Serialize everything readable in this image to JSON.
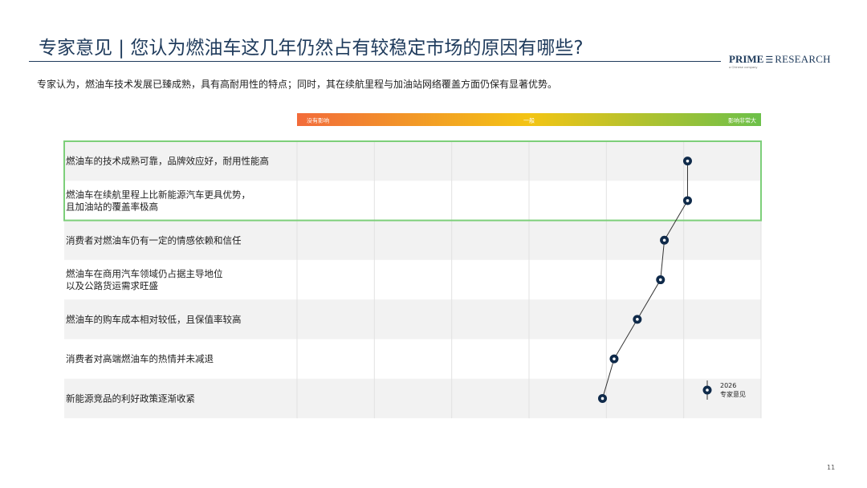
{
  "header": {
    "title": "专家意见 | 您认为燃油车这几年仍然占有较稳定市场的原因有哪些?",
    "subtitle": "专家认为，燃油车技术发展已臻成熟，具有高耐用性的特点；同时，其在续航里程与加油站网络覆盖方面仍保有显著优势。"
  },
  "logo": {
    "brand_bold": "PRIME",
    "brand_mark": "☰",
    "brand_light": "RESEARCH",
    "tagline": "a Chinese company"
  },
  "page_number": "11",
  "colors": {
    "title": "#1f3b5c",
    "gradient_left": "#f26b3a",
    "gradient_mid": "#f3c414",
    "gradient_right": "#6cc04a",
    "highlight_border": "#7dcf7a",
    "marker": "#0f2a4a",
    "row_shade": "#f2f2f2"
  },
  "chart_data": {
    "type": "line",
    "orientation": "horizontal-rows",
    "scale_labels": [
      "没有影响",
      "一般",
      "影响非常大"
    ],
    "x_range": [
      0,
      6
    ],
    "categories": [
      [
        "燃油车的技术成熟可靠，品牌效应好，耐用性能高"
      ],
      [
        "燃油车在续航里程上比新能源汽车更具优势，",
        "且加油站的覆盖率极高"
      ],
      [
        "消费者对燃油车仍有一定的情感依赖和信任"
      ],
      [
        "燃油车在商用汽车领域仍占据主导地位",
        "以及公路货运需求旺盛"
      ],
      [
        "燃油车的购车成本相对较低，且保值率较高"
      ],
      [
        "消费者对高端燃油车的热情并未减退"
      ],
      [
        "新能源竞品的利好政策逐渐收紧"
      ]
    ],
    "series": [
      {
        "name": "2026 专家意见",
        "values": [
          5.05,
          5.05,
          4.75,
          4.7,
          4.4,
          4.1,
          3.95
        ]
      }
    ],
    "legend": {
      "label_line1": "2026",
      "label_line2": "专家意见",
      "position": "bottom-right"
    },
    "highlighted_rows": [
      0,
      1
    ]
  }
}
